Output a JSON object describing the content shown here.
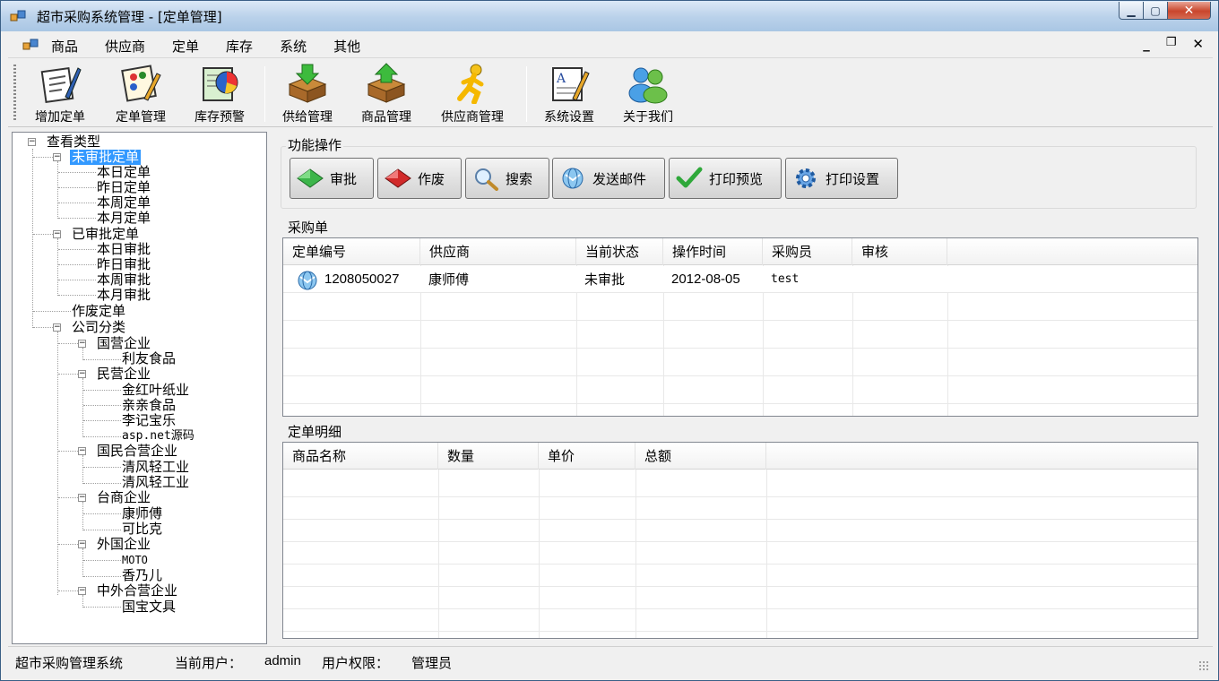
{
  "window": {
    "title": "超市采购系统管理 - [定单管理]"
  },
  "menu": {
    "items": [
      "商品",
      "供应商",
      "定单",
      "库存",
      "系统",
      "其他"
    ]
  },
  "mdi_controls": {
    "minimize": "_",
    "restore": "🗗",
    "close": "✕"
  },
  "toolbar": {
    "items": [
      {
        "label": "增加定单",
        "icon": "pen-paper-icon"
      },
      {
        "label": "定单管理",
        "icon": "palette-edit-icon"
      },
      {
        "label": "库存预警",
        "icon": "pie-chart-icon"
      },
      {
        "label": "供给管理",
        "icon": "box-down-icon"
      },
      {
        "label": "商品管理",
        "icon": "box-up-icon"
      },
      {
        "label": "供应商管理",
        "icon": "runner-icon"
      },
      {
        "label": "系统设置",
        "icon": "settings-doc-icon"
      },
      {
        "label": "关于我们",
        "icon": "users-icon"
      }
    ]
  },
  "tree": {
    "root": "查看类型",
    "unapproved": {
      "label": "未审批定单",
      "children": [
        "本日定单",
        "昨日定单",
        "本周定单",
        "本月定单"
      ]
    },
    "approved": {
      "label": "已审批定单",
      "children": [
        "本日审批",
        "昨日审批",
        "本周审批",
        "本月审批"
      ]
    },
    "void": "作废定单",
    "company": {
      "label": "公司分类",
      "state_owned": {
        "label": "国营企业",
        "children": [
          "利友食品"
        ]
      },
      "private": {
        "label": "民营企业",
        "children": [
          "金红叶纸业",
          "亲亲食品",
          "李记宝乐",
          "asp.net源码"
        ]
      },
      "joint": {
        "label": "国民合营企业",
        "children": [
          "清风轻工业",
          "清风轻工业"
        ]
      },
      "taiwan": {
        "label": "台商企业",
        "children": [
          "康师傅",
          "可比克"
        ]
      },
      "foreign": {
        "label": "外国企业",
        "children": [
          "MOTO",
          "香乃儿"
        ]
      },
      "sino_foreign": {
        "label": "中外合营企业",
        "children": [
          "国宝文具"
        ]
      }
    }
  },
  "actions": {
    "group_label": "功能操作",
    "buttons": [
      {
        "label": "审批",
        "icon": "green-diamond-icon"
      },
      {
        "label": "作废",
        "icon": "red-diamond-icon"
      },
      {
        "label": "搜索",
        "icon": "magnifier-icon"
      },
      {
        "label": "发送邮件",
        "icon": "mail-globe-icon"
      },
      {
        "label": "打印预览",
        "icon": "checkmark-icon"
      },
      {
        "label": "打印设置",
        "icon": "gear-icon"
      }
    ]
  },
  "orders": {
    "group_label": "采购单",
    "columns": [
      "定单编号",
      "供应商",
      "当前状态",
      "操作时间",
      "采购员",
      "审核"
    ],
    "rows": [
      {
        "id": "1208050027",
        "supplier": "康师傅",
        "status": "未审批",
        "time": "2012-08-05",
        "buyer": "test",
        "audit": ""
      }
    ]
  },
  "details": {
    "group_label": "定单明细",
    "columns": [
      "商品名称",
      "数量",
      "单价",
      "总额"
    ]
  },
  "status": {
    "app": "超市采购管理系统",
    "user_label": "当前用户：",
    "user": "admin",
    "perm_label": "用户权限：",
    "perm": "管理员"
  }
}
